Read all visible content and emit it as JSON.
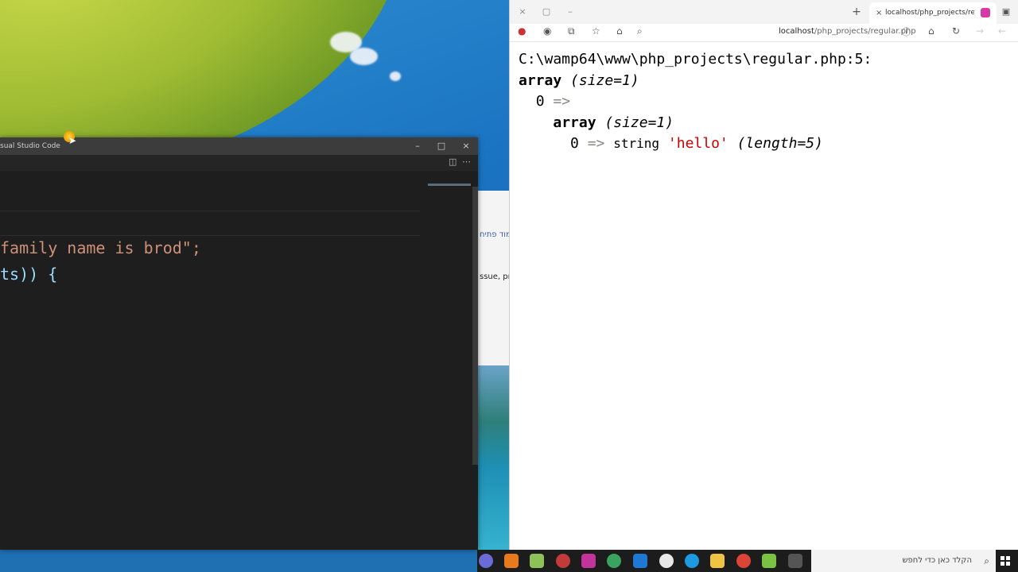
{
  "vscode": {
    "title": "sual Studio Code",
    "controls": {
      "minimize": "–",
      "maximize": "□",
      "close": "×"
    },
    "code_lines": [
      {
        "text": "family name is brod\";",
        "color": "#ce9178"
      },
      {
        "text": "ts)) {",
        "color": "#9cdcfe"
      }
    ]
  },
  "behind_window": {
    "text1": "עמוד פתיח",
    "text2": "ssue, prog"
  },
  "browser": {
    "controls": {
      "close": "×",
      "restore": "▢",
      "minimize": "–"
    },
    "new_tab": "+",
    "tab_label": "localhost/php_projects/regular.p",
    "address": {
      "host": "localhost",
      "path": "/php_projects/regular.php"
    },
    "dump": {
      "file_line": "C:\\wamp64\\www\\php_projects\\regular.php:5:",
      "outer_array_kw": "array",
      "outer_array_size": "(size=1)",
      "index0": "0",
      "arrow": "=>",
      "inner_array_kw": "array",
      "inner_array_size": "(size=1)",
      "inner_index": "0",
      "inner_type": "string",
      "inner_value": "'hello'",
      "inner_length": "(length=5)"
    }
  },
  "taskbar": {
    "search_placeholder": "הקלד כאן כדי לחפש",
    "icons": [
      "teams-icon",
      "vlc-icon",
      "notepadpp-icon",
      "app-red-icon",
      "onenote-icon",
      "edge-dev-icon",
      "outlook-icon",
      "photos-icon",
      "edge-icon",
      "file-explorer-icon",
      "chrome-icon",
      "notepad-icon",
      "task-view-icon"
    ]
  },
  "colors": {
    "vscode_bg": "#1e1e1e",
    "string_red": "#cc0000",
    "taskbar": "#1c1c1c"
  }
}
